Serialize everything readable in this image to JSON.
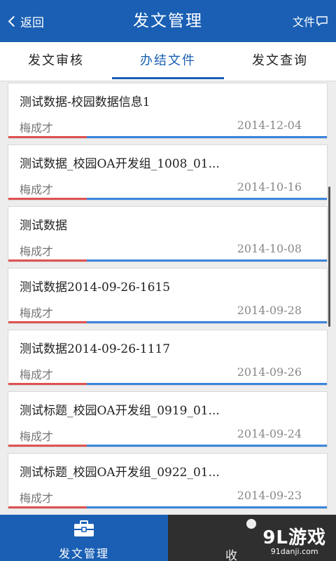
{
  "header": {
    "back_label": "返回",
    "title": "发文管理",
    "files_label": "文件"
  },
  "tabs": [
    {
      "label": "发文审核",
      "active": false
    },
    {
      "label": "办结文件",
      "active": true
    },
    {
      "label": "发文查询",
      "active": false
    }
  ],
  "list": [
    {
      "title": "测试数据-校园数据信息1",
      "author": "梅成才",
      "date": "2014-12-04"
    },
    {
      "title": "测试数据_校园OA开发组_1008_01...",
      "author": "梅成才",
      "date": "2014-10-16"
    },
    {
      "title": "测试数据",
      "author": "梅成才",
      "date": "2014-10-08"
    },
    {
      "title": "测试数据2014-09-26-1615",
      "author": "梅成才",
      "date": "2014-09-28"
    },
    {
      "title": "测试数据2014-09-26-1117",
      "author": "梅成才",
      "date": "2014-09-26"
    },
    {
      "title": "测试标题_校园OA开发组_0919_01...",
      "author": "梅成才",
      "date": "2014-09-24"
    },
    {
      "title": "测试标题_校园OA开发组_0922_01...",
      "author": "梅成才",
      "date": "2014-09-23"
    }
  ],
  "bottom_nav": {
    "left_label": "发文管理",
    "right_partial_label": "收",
    "watermark_main": "9L游戏",
    "watermark_sub": "91danji.com"
  },
  "colors": {
    "primary": "#1a5fb4",
    "accent_red": "#e05252",
    "accent_blue": "#3b86dc",
    "dark_nav": "#2f2f2f"
  }
}
